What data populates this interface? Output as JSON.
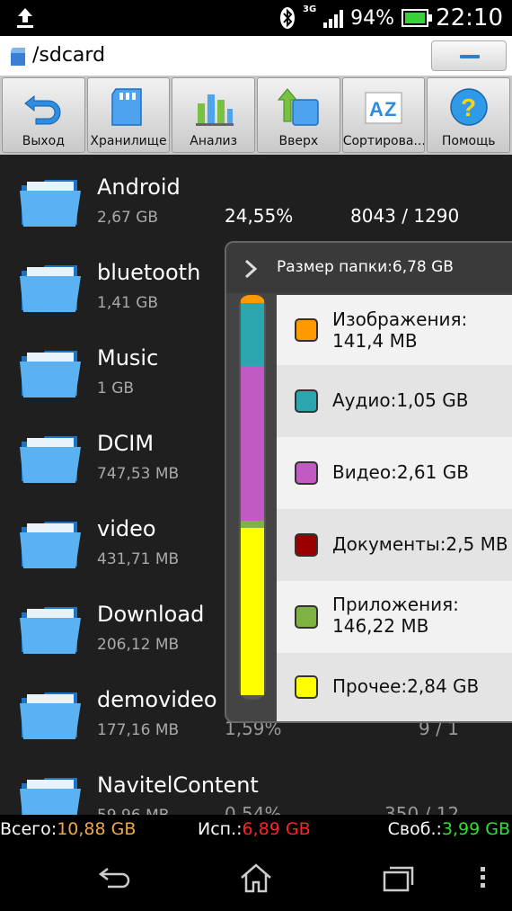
{
  "statusbar": {
    "network": "3G",
    "battery_percent": "94%",
    "time": "22:10"
  },
  "pathbar": {
    "path": "/sdcard"
  },
  "toolbar": {
    "buttons": [
      {
        "label": "Выход",
        "icon": "undo-arrow-icon"
      },
      {
        "label": "Хранилище",
        "icon": "sdcard-icon"
      },
      {
        "label": "Анализ",
        "icon": "bar-chart-icon"
      },
      {
        "label": "Вверх",
        "icon": "up-folder-icon"
      },
      {
        "label": "Сортирова...",
        "icon": "sort-az-icon"
      },
      {
        "label": "Помощь",
        "icon": "help-icon"
      }
    ]
  },
  "files": [
    {
      "name": "Android",
      "size": "2,67 GB",
      "percent": "24,55%",
      "count": "8043 / 1290"
    },
    {
      "name": "bluetooth",
      "size": "1,41 GB"
    },
    {
      "name": "Music",
      "size": "1 GB"
    },
    {
      "name": "DCIM",
      "size": "747,53 MB"
    },
    {
      "name": "video",
      "size": "431,71 MB"
    },
    {
      "name": "Download",
      "size": "206,12 MB"
    },
    {
      "name": "demovideo",
      "size": "177,16 MB",
      "percent": "1,59%",
      "count": "9 / 1"
    },
    {
      "name": "NavitelContent",
      "size": "59,96 MB",
      "percent": "0,54%",
      "count": "350 / 12"
    }
  ],
  "popup": {
    "title": "Размер папки:6,78 GB",
    "categories": [
      {
        "line1": "Изображения:",
        "line2": "141,4 MB",
        "color": "#FF9900"
      },
      {
        "line1": "Аудио:1,05 GB",
        "line2": "",
        "color": "#2AA6AE"
      },
      {
        "line1": "Видео:2,61 GB",
        "line2": "",
        "color": "#C15BC4"
      },
      {
        "line1": "Документы:2,5 MB",
        "line2": "",
        "color": "#990000"
      },
      {
        "line1": "Приложения:",
        "line2": "146,22 MB",
        "color": "#7CB342"
      },
      {
        "line1": "Прочее:2,84 GB",
        "line2": "",
        "color": "#FFFF00"
      }
    ]
  },
  "summary": {
    "total_label": "Всего:",
    "total_value": "10,88 GB",
    "used_label": "Исп.:",
    "used_value": "6,89 GB",
    "free_label": "Своб.:",
    "free_value": "3,99 GB",
    "total_color": "#F0A64A",
    "used_color": "#FF2222",
    "free_color": "#33DD33"
  }
}
